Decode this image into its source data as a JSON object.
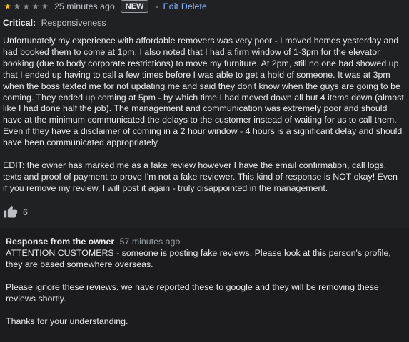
{
  "review": {
    "rating": 1,
    "max_rating": 5,
    "time_ago": "25 minutes ago",
    "badge": "NEW",
    "separator": "-",
    "edit_label": "Edit",
    "delete_label": "Delete",
    "critical_label": "Critical:",
    "critical_value": "Responsiveness",
    "paragraphs": [
      "Unfortunately my experience with affordable removers was very poor - I moved homes yesterday and had booked them to come at 1pm. I also noted that I had a firm window of 1-3pm for the elevator booking (due to body corporate restrictions) to move my furniture. At 2pm, still no one had showed up that I ended up having to call a few times before I was able to get a hold of someone. It was at 3pm when the boss texted me for not updating me and said they don't know when the guys are going to be coming. They ended up coming at 5pm - by which time I had moved down all but 4 items down (almost like I had done half the job). The management and communication was extremely poor and should have at the minimum communicated the delays to the customer instead of waiting for us to call them. Even if they have a disclaimer of coming in a 2 hour window - 4 hours is a significant delay and should have been communicated appropriately.",
      "EDIT: the owner has marked me as a fake review however I have the email confirmation, call logs, texts and proof of payment to prove I'm not a fake reviewer. This kind of response is NOT okay! Even if you remove my review, I will post it again - truly disappointed in the management."
    ],
    "likes": "6",
    "star_icon": "star-icon",
    "thumb_icon": "thumbs-up-icon",
    "star_color": "#fbbc04",
    "link_color": "#8ab4f8"
  },
  "owner_response": {
    "label": "Response from the owner",
    "time_ago": "57 minutes ago",
    "paragraphs": [
      "ATTENTION CUSTOMERS - someone is posting fake reviews. Please look at this person's profile, they are based somewhere overseas.",
      "Please ignore these reviews. we have reported these to google and they will be removing these reviews shortly.",
      "Thanks for your understanding."
    ]
  }
}
